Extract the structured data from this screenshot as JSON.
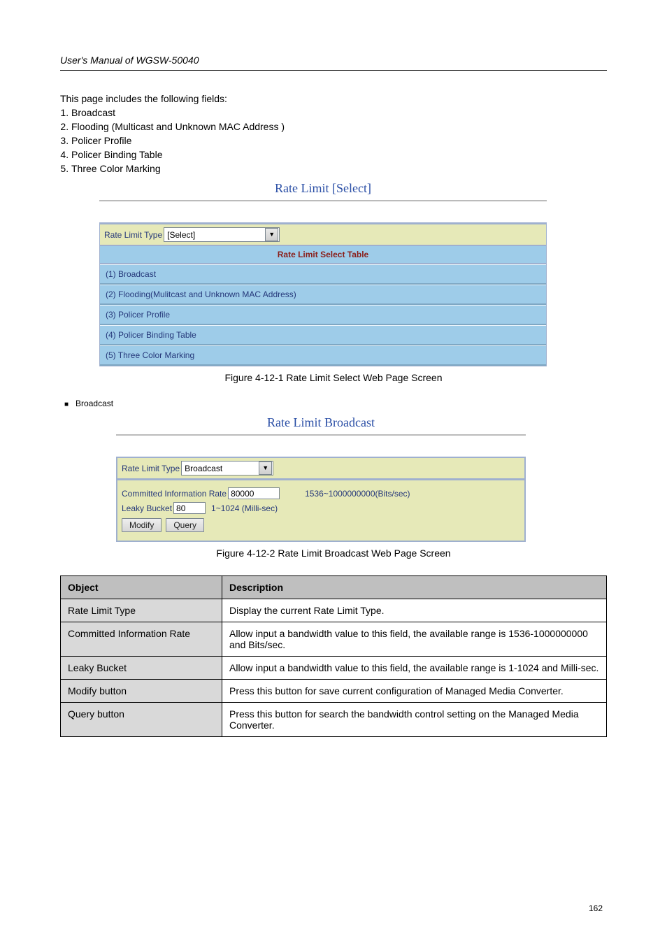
{
  "page_number": "162",
  "header": {
    "user_manual": "User's Manual of WGSW-50040"
  },
  "intro_heading": "This page includes the following fields:",
  "intro_items": [
    "Broadcast",
    "Flooding (Multicast and Unknown MAC Address )",
    "Policer Profile",
    "Policer Binding Table",
    "Three Color Marking"
  ],
  "fig1": {
    "title": "Rate Limit [Select]",
    "select_label": "Rate Limit Type",
    "select_value": "[Select]",
    "table_heading": "Rate Limit Select Table",
    "rows": [
      "(1) Broadcast",
      "(2) Flooding(Mulitcast and Unknown MAC Address)",
      "(3) Policer Profile",
      "(4) Policer Binding Table",
      "(5) Three Color Marking"
    ],
    "caption": "Figure 4-12-1 Rate Limit Select Web Page Screen"
  },
  "bullet_broadcast": "Broadcast",
  "fig2": {
    "title": "Rate Limit Broadcast",
    "select_label": "Rate Limit Type",
    "select_value": "Broadcast",
    "cir_label": "Committed Information Rate",
    "cir_value": "80000",
    "cir_hint": "1536~1000000000(Bits/sec)",
    "lb_label": "Leaky Bucket",
    "lb_value": "80",
    "lb_hint": "1~1024 (Milli-sec)",
    "btn_modify": "Modify",
    "btn_query": "Query",
    "caption": "Figure 4-12-2 Rate Limit Broadcast Web Page Screen"
  },
  "table": {
    "head_object": "Object",
    "head_desc": "Description",
    "rows": [
      {
        "obj": "Rate Limit Type",
        "desc": "Display the current Rate Limit Type."
      },
      {
        "obj": "Committed Information Rate",
        "desc": "Allow input a bandwidth value to this field, the available range is 1536-1000000000 and Bits/sec."
      },
      {
        "obj": "Leaky Bucket",
        "desc": "Allow input a bandwidth value to this field, the available range is 1-1024 and Milli-sec."
      },
      {
        "obj": "Modify button",
        "desc": "Press this button for save current configuration of Managed Media Converter."
      },
      {
        "obj": "Query button",
        "desc": "Press this button for search the bandwidth control setting on the Managed Media Converter."
      }
    ]
  }
}
